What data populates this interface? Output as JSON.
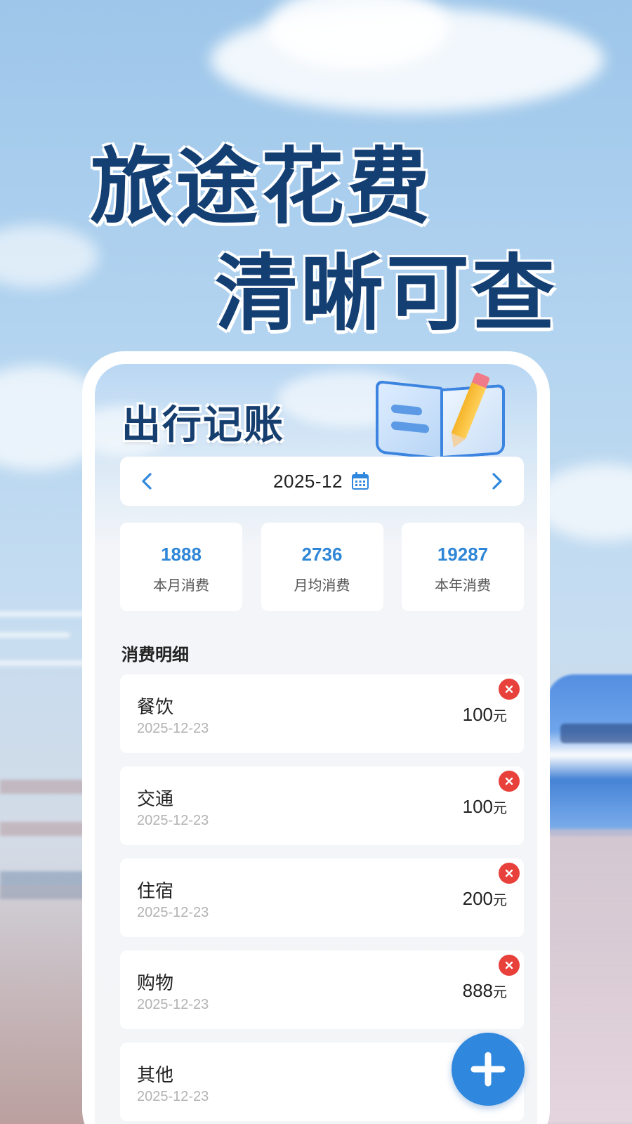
{
  "promo": {
    "line1": "旅途花费",
    "line2": "清晰可查"
  },
  "app": {
    "title": "出行记账"
  },
  "month_selector": {
    "current": "2025-12",
    "prev_icon": "chevron-left-icon",
    "next_icon": "chevron-right-icon",
    "calendar_icon": "calendar-icon"
  },
  "stats": [
    {
      "value": "1888",
      "label": "本月消费"
    },
    {
      "value": "2736",
      "label": "月均消费"
    },
    {
      "value": "19287",
      "label": "本年消费"
    }
  ],
  "details": {
    "title": "消费明细",
    "unit": "元",
    "items": [
      {
        "category": "餐饮",
        "date": "2025-12-23",
        "amount": "100"
      },
      {
        "category": "交通",
        "date": "2025-12-23",
        "amount": "100"
      },
      {
        "category": "住宿",
        "date": "2025-12-23",
        "amount": "200"
      },
      {
        "category": "购物",
        "date": "2025-12-23",
        "amount": "888"
      },
      {
        "category": "其他",
        "date": "2025-12-23",
        "amount": ""
      }
    ]
  },
  "colors": {
    "accent": "#2f88dd",
    "headline": "#143f73",
    "delete": "#e8403a"
  }
}
